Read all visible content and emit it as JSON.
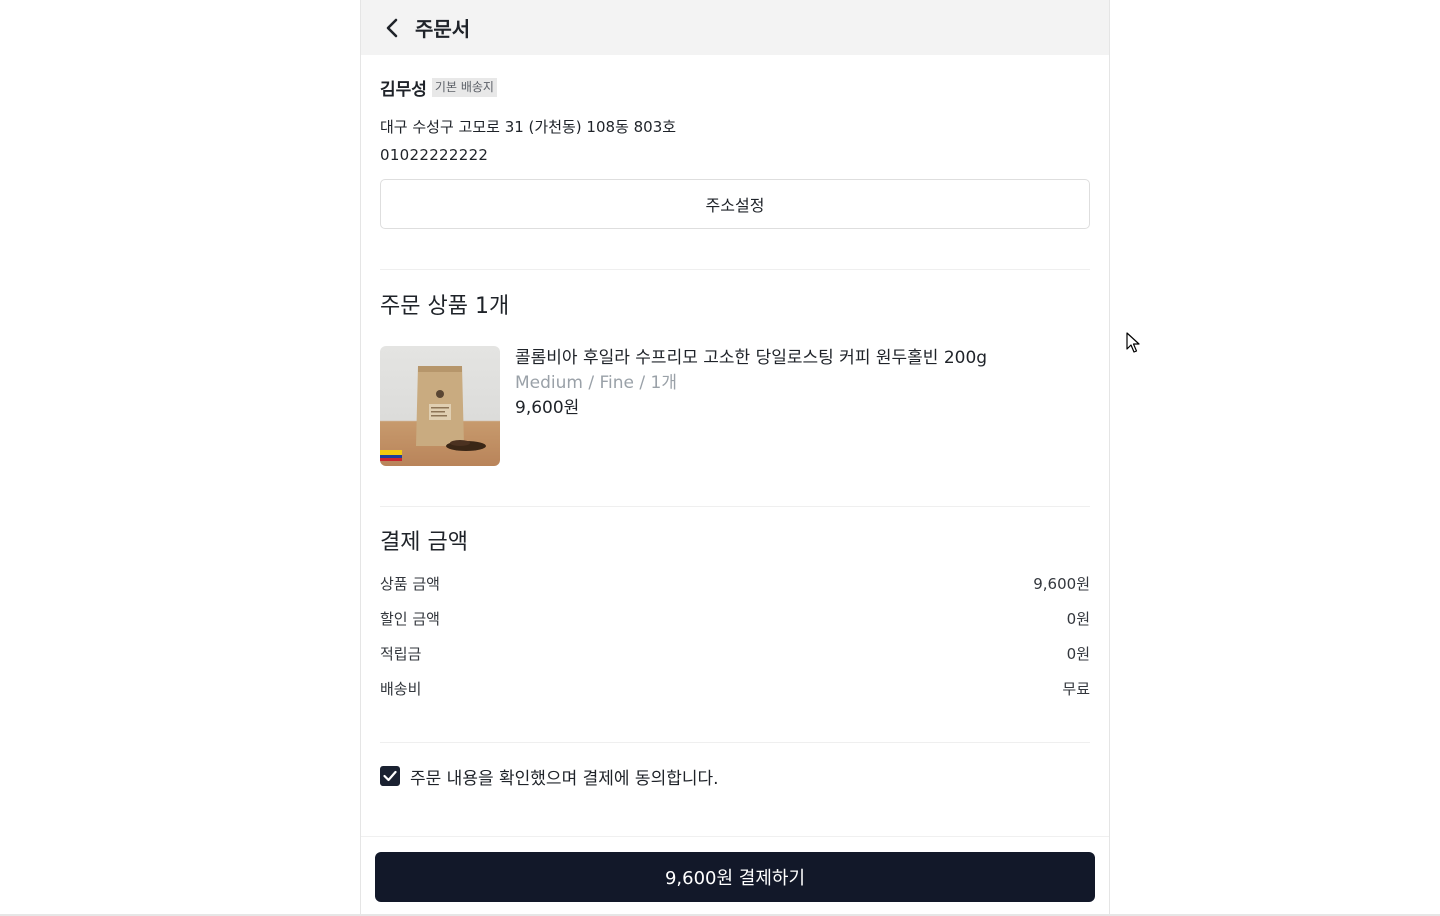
{
  "header": {
    "title": "주문서"
  },
  "address": {
    "name": "김무성",
    "badge": "기본 배송지",
    "line": "대구 수성구 고모로 31 (가천동)  108동 803호",
    "phone": "01022222222",
    "button_label": "주소설정"
  },
  "order": {
    "title": "주문 상품 1개",
    "items": [
      {
        "name": "콜롬비아 후일라 수프리모 고소한 당일로스팅 커피 원두홀빈 200g",
        "option": "Medium / Fine / 1개",
        "price": "9,600원",
        "image": "coffee-bag-image"
      }
    ]
  },
  "payment": {
    "title": "결제 금액",
    "rows": [
      {
        "label": "상품 금액",
        "value": "9,600원"
      },
      {
        "label": "할인 금액",
        "value": "0원"
      },
      {
        "label": "적립금",
        "value": "0원"
      },
      {
        "label": "배송비",
        "value": "무료"
      }
    ]
  },
  "agreement": {
    "label": "주문 내용을 확인했으며 결제에 동의합니다.",
    "checked": true
  },
  "pay_button": {
    "label": "9,600원 결제하기"
  },
  "colors": {
    "header_bg": "#f3f3f3",
    "button_bg": "#121829",
    "option_text": "#9aa1a8"
  }
}
